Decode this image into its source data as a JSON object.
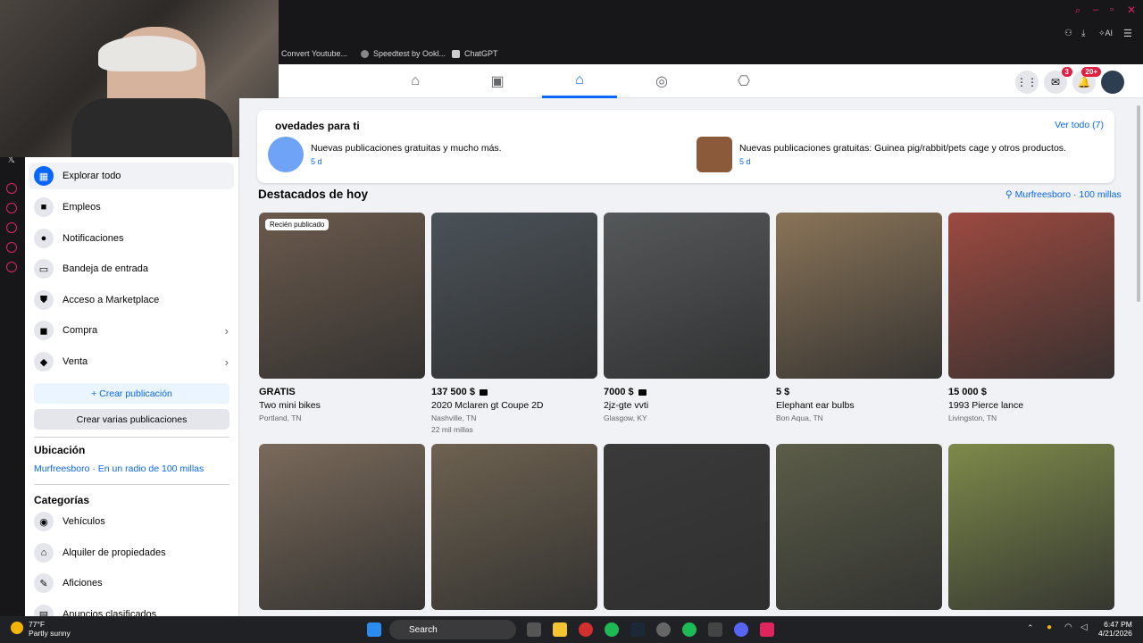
{
  "bookmarks": [
    "Convert Youtube...",
    "Speedtest by Ookl...",
    "ChatGPT"
  ],
  "nav": {
    "tabs": [
      "home",
      "video",
      "marketplace",
      "groups",
      "gaming"
    ],
    "messenger_badge": "3",
    "notif_badge": "20+"
  },
  "sidebar": {
    "items": [
      {
        "label": "Explorar todo",
        "icon": "store-icon"
      },
      {
        "label": "Empleos",
        "icon": "briefcase-icon"
      },
      {
        "label": "Notificaciones",
        "icon": "bell-icon"
      },
      {
        "label": "Bandeja de entrada",
        "icon": "inbox-icon"
      },
      {
        "label": "Acceso a Marketplace",
        "icon": "shield-icon"
      },
      {
        "label": "Compra",
        "icon": "bag-icon"
      },
      {
        "label": "Venta",
        "icon": "tag-icon"
      }
    ],
    "create_label": "+ Crear publicación",
    "create_multi_label": "Crear varias publicaciones",
    "location_heading": "Ubicación",
    "location_value": "Murfreesboro · En un radio de 100 millas",
    "categories_heading": "Categorías",
    "categories": [
      "Vehículos",
      "Alquiler de propiedades",
      "Aficiones",
      "Anuncios clasificados"
    ]
  },
  "news": {
    "heading": "ovedades para ti",
    "see_all": "Ver todo (7)",
    "items": [
      {
        "text": "Nuevas publicaciones gratuitas y mucho más.",
        "time": "5 d"
      },
      {
        "text": "Nuevas publicaciones gratuitas: Guinea pig/rabbit/pets cage y otros productos.",
        "time": "5 d"
      }
    ]
  },
  "today": {
    "heading": "Destacados de hoy",
    "location": "Murfreesboro · 100 millas"
  },
  "products": [
    {
      "badge": "Recién publicado",
      "price": "GRATIS",
      "title": "Two mini bikes",
      "location": "Portland, TN",
      "video": false,
      "distance": "",
      "color": "#6b5a4c"
    },
    {
      "badge": "",
      "price": "137 500 $",
      "title": "2020 Mclaren gt Coupe 2D",
      "location": "Nashville, TN",
      "video": true,
      "distance": "22 mil millas",
      "color": "#4a5258"
    },
    {
      "badge": "",
      "price": "7000 $",
      "title": "2jz-gte vvti",
      "location": "Glasgow, KY",
      "video": true,
      "distance": "",
      "color": "#55585a"
    },
    {
      "badge": "",
      "price": "5 $",
      "title": "Elephant ear bulbs",
      "location": "Bon Aqua, TN",
      "video": false,
      "distance": "",
      "color": "#8a7458"
    },
    {
      "badge": "",
      "price": "15 000 $",
      "title": "1993 Pierce lance",
      "location": "Livingston, TN",
      "video": false,
      "distance": "",
      "color": "#9c4a40"
    },
    {
      "badge": "",
      "price": "",
      "title": "",
      "location": "",
      "video": false,
      "distance": "",
      "color": "#7a6a5a"
    },
    {
      "badge": "",
      "price": "",
      "title": "",
      "location": "",
      "video": false,
      "distance": "",
      "color": "#6e6250"
    },
    {
      "badge": "",
      "price": "",
      "title": "",
      "location": "",
      "video": false,
      "distance": "",
      "color": "#3a3a3a"
    },
    {
      "badge": "",
      "price": "",
      "title": "",
      "location": "",
      "video": false,
      "distance": "",
      "color": "#5b5d48"
    },
    {
      "badge": "",
      "price": "",
      "title": "",
      "location": "",
      "video": false,
      "distance": "",
      "color": "#7d8a4a"
    }
  ],
  "taskbar": {
    "weather_temp": "77°F",
    "weather_desc": "Partly sunny",
    "search": "Search",
    "time": "6:47 PM",
    "date": "4/21/2026"
  },
  "colors": {
    "accent": "#0866ff",
    "bg": "#f0f2f5"
  }
}
